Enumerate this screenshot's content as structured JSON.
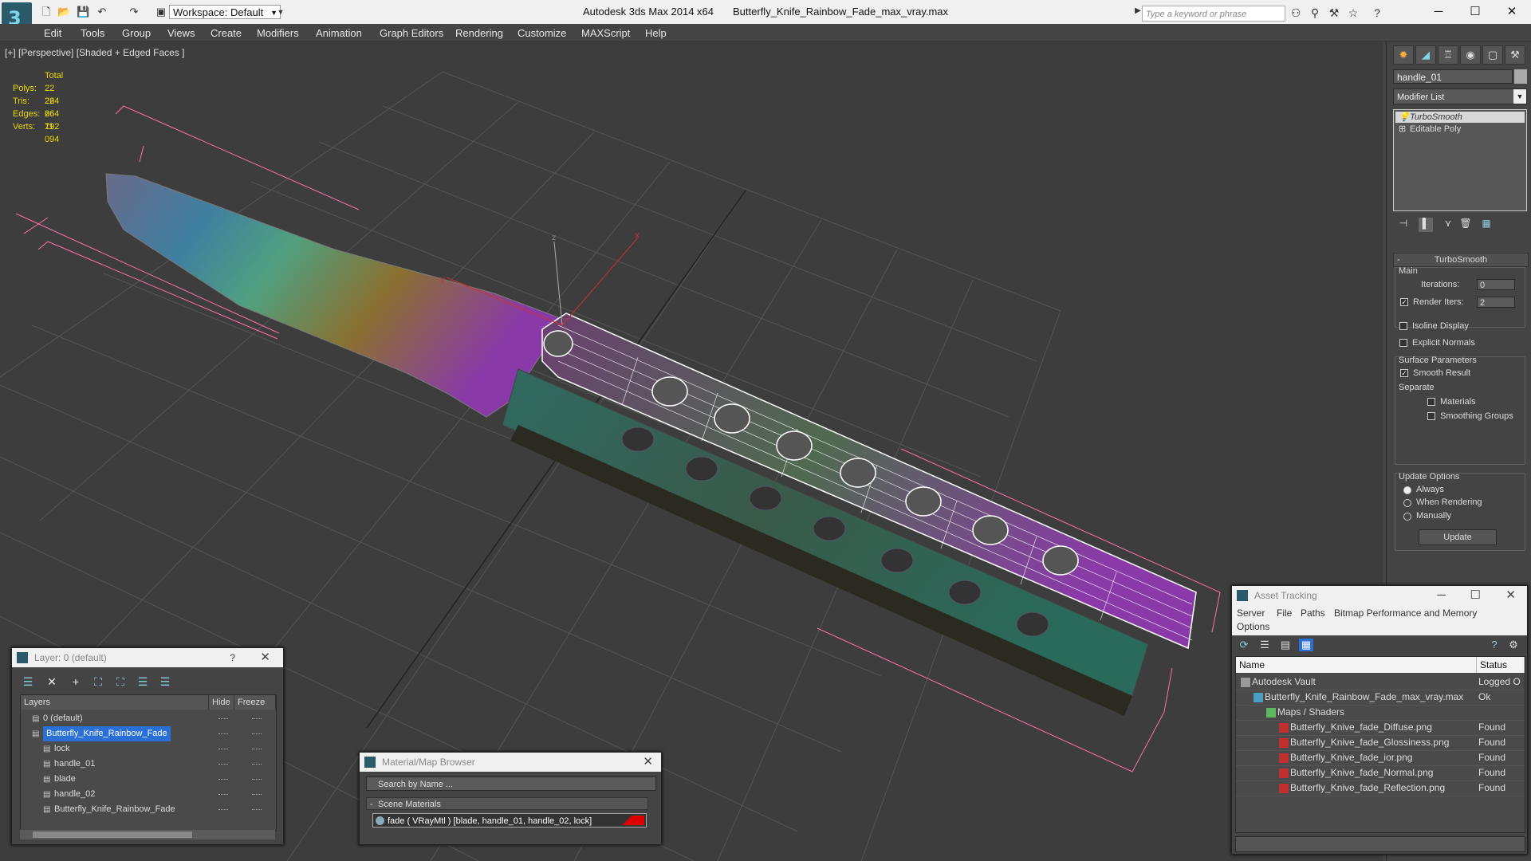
{
  "titlebar": {
    "app_title": "Autodesk 3ds Max  2014 x64",
    "file_name": "Butterfly_Knife_Rainbow_Fade_max_vray.max",
    "workspace": "Workspace: Default",
    "search_placeholder": "Type a keyword or phrase"
  },
  "menu": [
    "Edit",
    "Tools",
    "Group",
    "Views",
    "Create",
    "Modifiers",
    "Animation",
    "Graph Editors",
    "Rendering",
    "Customize",
    "MAXScript",
    "Help"
  ],
  "viewport": {
    "label": "[+] [Perspective] [Shaded + Edged Faces ]",
    "stats_header": "Total",
    "stats": [
      {
        "label": "Polys:",
        "value": "22 264"
      },
      {
        "label": "Tris:",
        "value": "22 264"
      },
      {
        "label": "Edges:",
        "value": "66 792"
      },
      {
        "label": "Verts:",
        "value": "11 094"
      }
    ],
    "axis_x": "x",
    "axis_y": "y",
    "axis_z": "z"
  },
  "command_panel": {
    "object_name": "handle_01",
    "modifier_list": "Modifier List",
    "stack": [
      "TurboSmooth",
      "Editable Poly"
    ],
    "rollout_title": "TurboSmooth",
    "main_label": "Main",
    "iterations_label": "Iterations:",
    "iterations_value": "0",
    "render_iters_label": "Render Iters:",
    "render_iters_value": "2",
    "isoline_display": "Isoline Display",
    "explicit_normals": "Explicit Normals",
    "surface_params": "Surface Parameters",
    "smooth_result": "Smooth Result",
    "separate": "Separate",
    "materials": "Materials",
    "smoothing_groups": "Smoothing Groups",
    "update_options": "Update Options",
    "always": "Always",
    "when_rendering": "When Rendering",
    "manually": "Manually",
    "update_button": "Update"
  },
  "layer_dialog": {
    "title": "Layer: 0 (default)",
    "help": "?",
    "columns": {
      "layers": "Layers",
      "hide": "Hide",
      "freeze": "Freeze"
    },
    "rows": [
      {
        "name": "0 (default)",
        "indent": 14,
        "selected": false
      },
      {
        "name": "Butterfly_Knife_Rainbow_Fade",
        "indent": 14,
        "selected": true
      },
      {
        "name": "lock",
        "indent": 28,
        "selected": false
      },
      {
        "name": "handle_01",
        "indent": 28,
        "selected": false
      },
      {
        "name": "blade",
        "indent": 28,
        "selected": false
      },
      {
        "name": "handle_02",
        "indent": 28,
        "selected": false
      },
      {
        "name": "Butterfly_Knife_Rainbow_Fade",
        "indent": 28,
        "selected": false
      }
    ]
  },
  "material_browser": {
    "title": "Material/Map Browser",
    "search_placeholder": "Search by Name ...",
    "section": "Scene Materials",
    "item": "fade  ( VRayMtl )  [blade, handle_01, handle_02, lock]"
  },
  "asset_tracking": {
    "title": "Asset Tracking",
    "menu": [
      "Server",
      "File",
      "Paths",
      "Bitmap Performance and Memory",
      "Options"
    ],
    "columns": {
      "name": "Name",
      "status": "Status"
    },
    "rows": [
      {
        "name": "Autodesk Vault",
        "status": "Logged O",
        "indent": 20
      },
      {
        "name": "Butterfly_Knife_Rainbow_Fade_max_vray.max",
        "status": "Ok",
        "indent": 36
      },
      {
        "name": "Maps / Shaders",
        "status": "",
        "indent": 52
      },
      {
        "name": "Butterfly_Knive_fade_Diffuse.png",
        "status": "Found",
        "indent": 68
      },
      {
        "name": "Butterfly_Knive_fade_Glossiness.png",
        "status": "Found",
        "indent": 68
      },
      {
        "name": "Butterfly_Knive_fade_ior.png",
        "status": "Found",
        "indent": 68
      },
      {
        "name": "Butterfly_Knive_fade_Normal.png",
        "status": "Found",
        "indent": 68
      },
      {
        "name": "Butterfly_Knive_fade_Reflection.png",
        "status": "Found",
        "indent": 68
      }
    ]
  },
  "colors": {
    "viewport_bg": "#3d3d3d",
    "stats_text": "#e8d900",
    "selection": "#2a6fd6",
    "bbox": "#ff6fa8"
  }
}
